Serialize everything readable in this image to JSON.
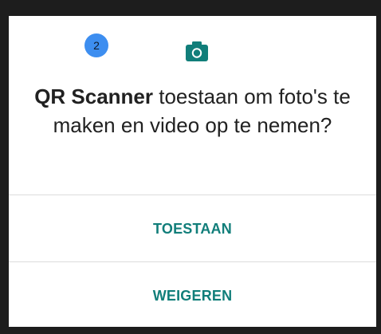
{
  "dialog": {
    "step_badge": "2",
    "icon": "camera-icon",
    "app_name": "QR Scanner",
    "message_rest": " toestaan om foto's te maken en video op te nemen?",
    "allow_label": "TOESTAAN",
    "deny_label": "WEIGEREN"
  },
  "colors": {
    "badge": "#3d8ef0",
    "accent": "#117e7a",
    "text": "#212121",
    "frame": "#1d1d1d"
  }
}
